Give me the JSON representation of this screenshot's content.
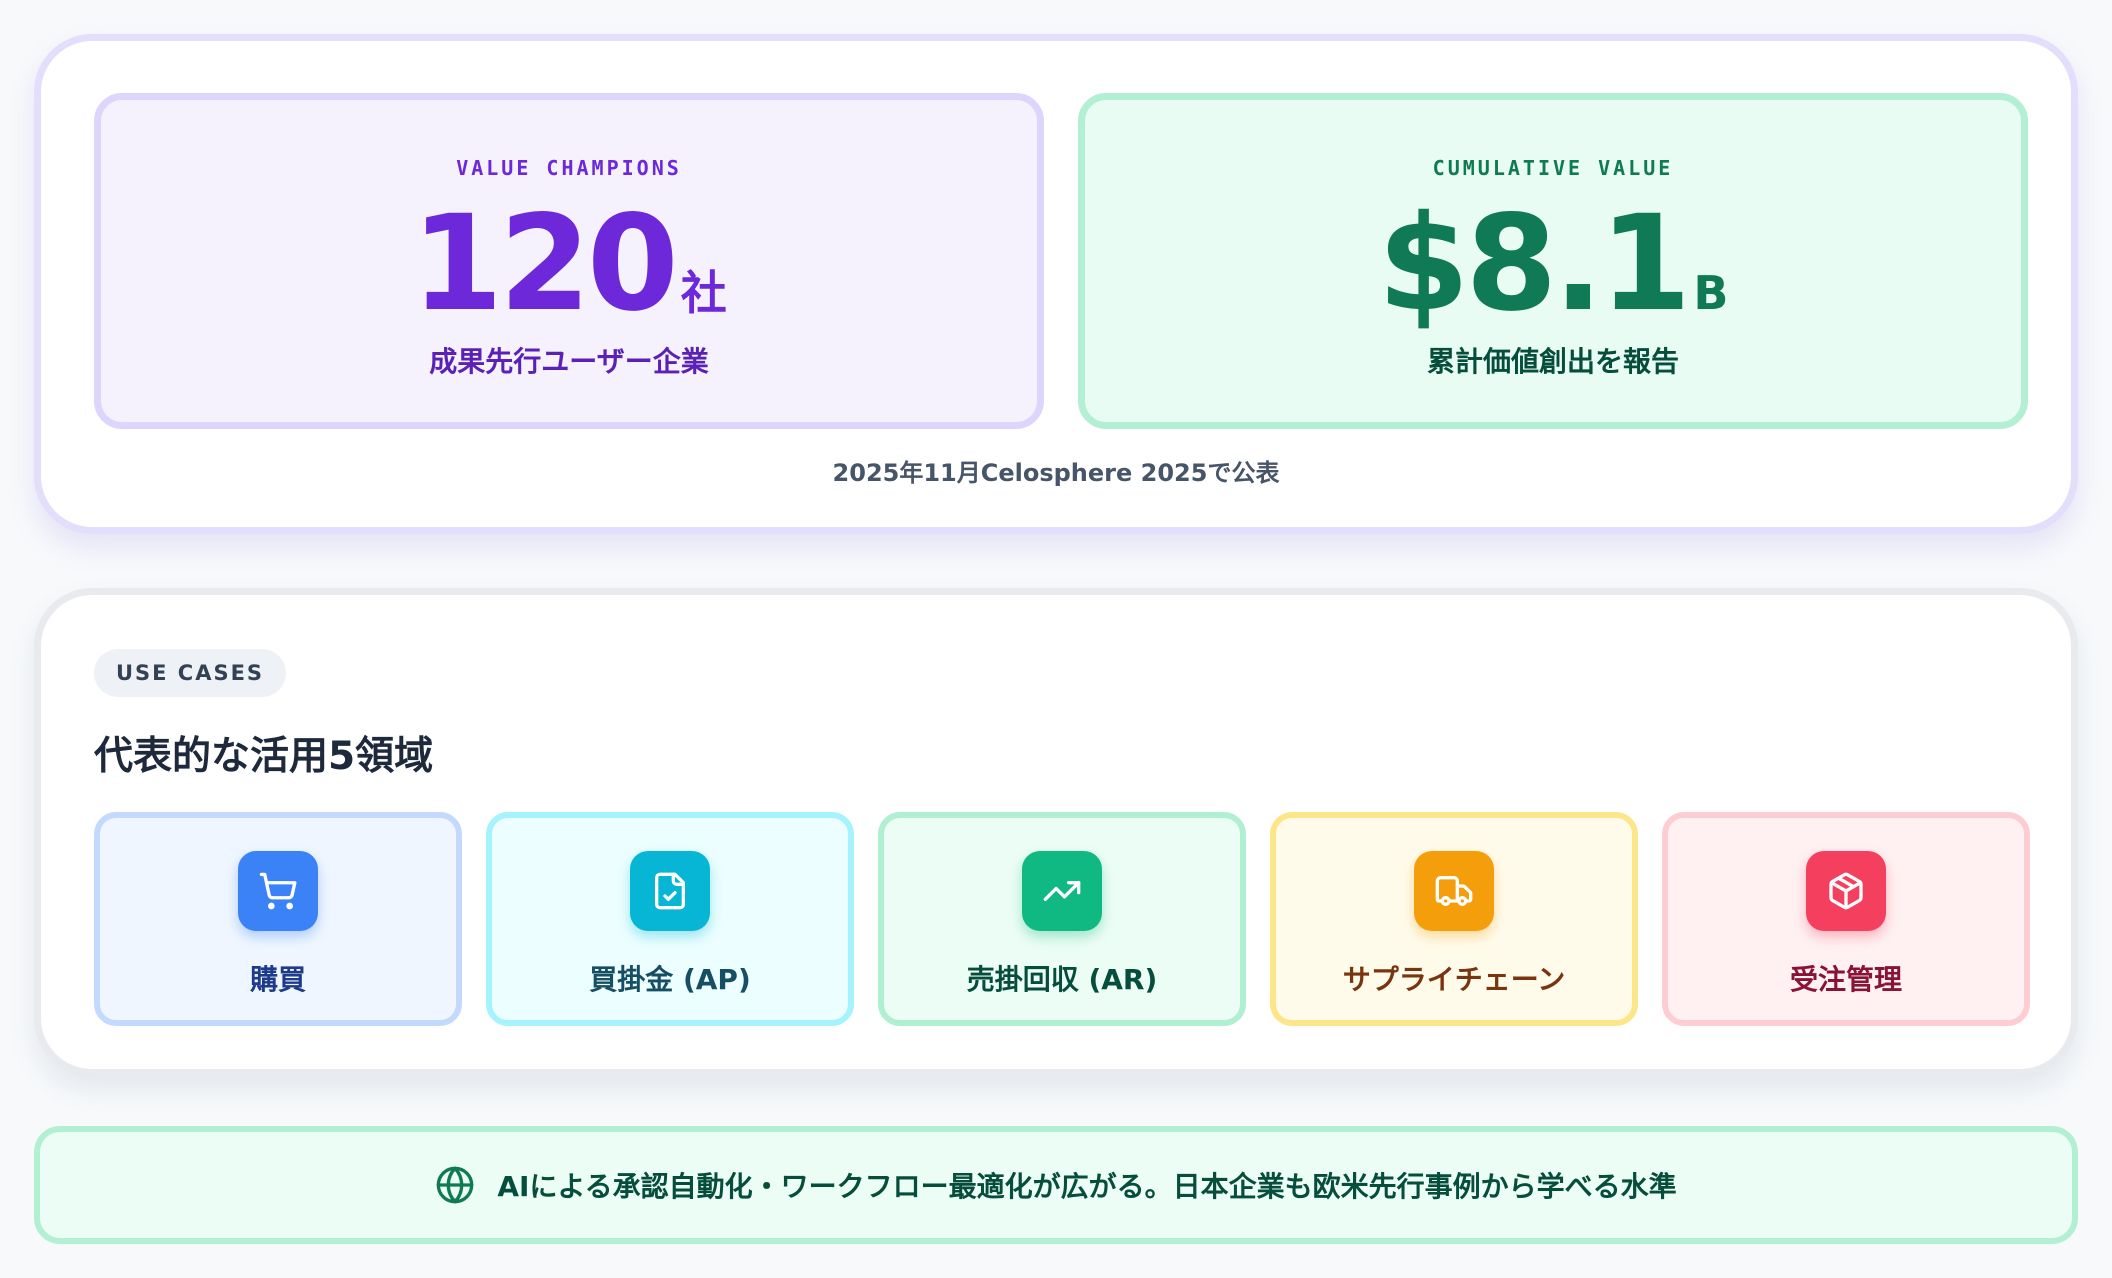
{
  "hero": {
    "champions": {
      "kicker": "VALUE CHAMPIONS",
      "number": "120",
      "unit": "社",
      "description": "成果先行ユーザー企業"
    },
    "cumulative": {
      "kicker": "CUMULATIVE VALUE",
      "number": "$8.1",
      "unit": "B",
      "description": "累計価値創出を報告"
    },
    "note": "2025年11月Celosphere 2025で公表"
  },
  "use_cases": {
    "pill": "USE CASES",
    "title": "代表的な活用5領域",
    "items": [
      {
        "label": "購買",
        "icon": "shopping-cart-icon",
        "color": "#3b82f6"
      },
      {
        "label": "買掛金 (AP)",
        "icon": "file-check-icon",
        "color": "#06b6d4"
      },
      {
        "label": "売掛回収 (AR)",
        "icon": "trending-up-icon",
        "color": "#10b981"
      },
      {
        "label": "サプライチェーン",
        "icon": "truck-icon",
        "color": "#f59e0b"
      },
      {
        "label": "受注管理",
        "icon": "package-icon",
        "color": "#f43f5e"
      }
    ]
  },
  "banner": {
    "icon": "globe-icon",
    "text": "AIによる承認自動化・ワークフロー最適化が広がる。日本企業も欧米先行事例から学べる水準"
  },
  "colors": {
    "purple": "#6d28d9",
    "green": "#0f7a55"
  }
}
